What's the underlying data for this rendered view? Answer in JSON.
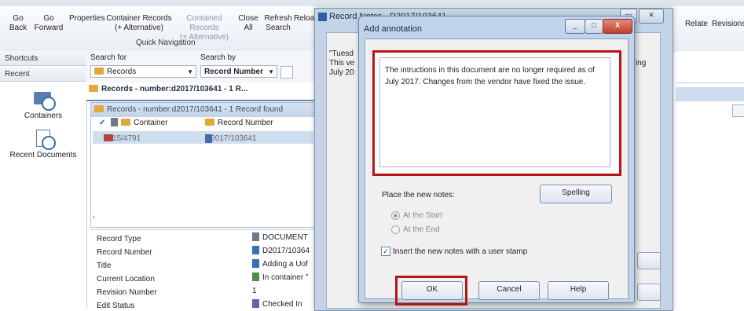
{
  "ribbon": {
    "buttons": [
      {
        "label": "Go\nBack"
      },
      {
        "label": "Go\nForward"
      },
      {
        "label": "Properties"
      },
      {
        "label": "Container Records\n(+ Alternative)"
      },
      {
        "label": "Contained Records\n(+ Alternative)"
      },
      {
        "label": "Close\nAll"
      },
      {
        "label": "Refresh\nSearch"
      },
      {
        "label": "Reload"
      }
    ],
    "group_label": "Quick Navigation"
  },
  "right_ribbon": {
    "relate": "Relate",
    "revisions": "Revisions"
  },
  "sidebar": {
    "shortcuts": "Shortcuts",
    "recent": "Recent",
    "tiles": [
      {
        "label": "Containers"
      },
      {
        "label": "Recent Documents"
      }
    ]
  },
  "search": {
    "search_for_label": "Search for",
    "search_by_label": "Search by",
    "search_for_value": "Records",
    "search_by_value": "Record Number"
  },
  "tab": {
    "label": "Records - number:d2017/103641 - 1 R..."
  },
  "results": {
    "panel_title": "Records - number:d2017/103641 - 1 Record found",
    "columns": [
      "Container",
      "Record Number"
    ],
    "row": {
      "container": "2015/4791",
      "record_number": "D2017/103641"
    }
  },
  "details": {
    "rows": [
      {
        "label": "Record Type",
        "value": "DOCUMENT"
      },
      {
        "label": "Record Number",
        "value": "D2017/10364"
      },
      {
        "label": "Title",
        "value": "Adding a Uof"
      },
      {
        "label": "Current Location",
        "value": "In container \""
      },
      {
        "label": "Revision Number",
        "value": "1"
      },
      {
        "label": "Edit Status",
        "value": "Checked In"
      }
    ]
  },
  "notes_window": {
    "title": "Record Notes - D2017/103641",
    "text_lines": [
      "\"Tuesd",
      "This ve",
      "July 20"
    ],
    "right_text": "ing"
  },
  "dialog": {
    "title": "Add annotation",
    "text": "The intructions in this document are no longer required as of July 2017. Changes from the vendor have fixed the issue.",
    "place_label": "Place the new notes:",
    "spelling": "Spelling",
    "at_start": "At the Start",
    "at_end": "At the End",
    "stamp_label": "Insert the new notes with a user stamp",
    "ok": "OK",
    "cancel": "Cancel",
    "help": "Help"
  },
  "colors": {
    "highlight": "#b61515",
    "selection": "#cfdeef"
  }
}
